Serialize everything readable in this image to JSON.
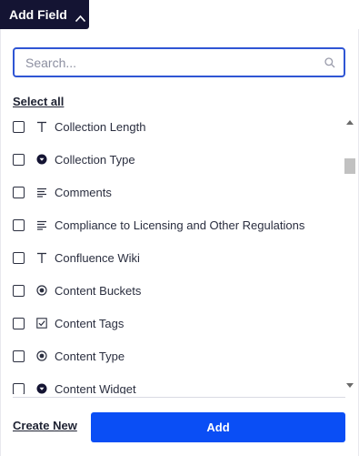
{
  "header": {
    "title": "Add Field",
    "toggle_icon": "chevron-up-icon"
  },
  "search": {
    "placeholder": "Search...",
    "value": "",
    "icon": "search-icon"
  },
  "select_all_label": "Select all",
  "fields": [
    {
      "label": "Collection Length",
      "type_icon": "text-type-icon",
      "checked": false
    },
    {
      "label": "Collection Type",
      "type_icon": "dropdown-type-icon",
      "checked": false
    },
    {
      "label": "Comments",
      "type_icon": "paragraph-type-icon",
      "checked": false
    },
    {
      "label": "Compliance to Licensing and Other Regulations",
      "type_icon": "paragraph-type-icon",
      "checked": false
    },
    {
      "label": "Confluence Wiki",
      "type_icon": "text-type-icon",
      "checked": false
    },
    {
      "label": "Content Buckets",
      "type_icon": "radio-type-icon",
      "checked": false
    },
    {
      "label": "Content Tags",
      "type_icon": "checkbox-type-icon",
      "checked": false
    },
    {
      "label": "Content Type",
      "type_icon": "radio-type-icon",
      "checked": false
    },
    {
      "label": "Content Widget",
      "type_icon": "dropdown-type-icon",
      "checked": false
    }
  ],
  "footer": {
    "create_new_label": "Create New",
    "add_label": "Add"
  },
  "colors": {
    "header_bg": "#141433",
    "accent": "#0a4ef5",
    "focus_border": "#2f55d4"
  }
}
